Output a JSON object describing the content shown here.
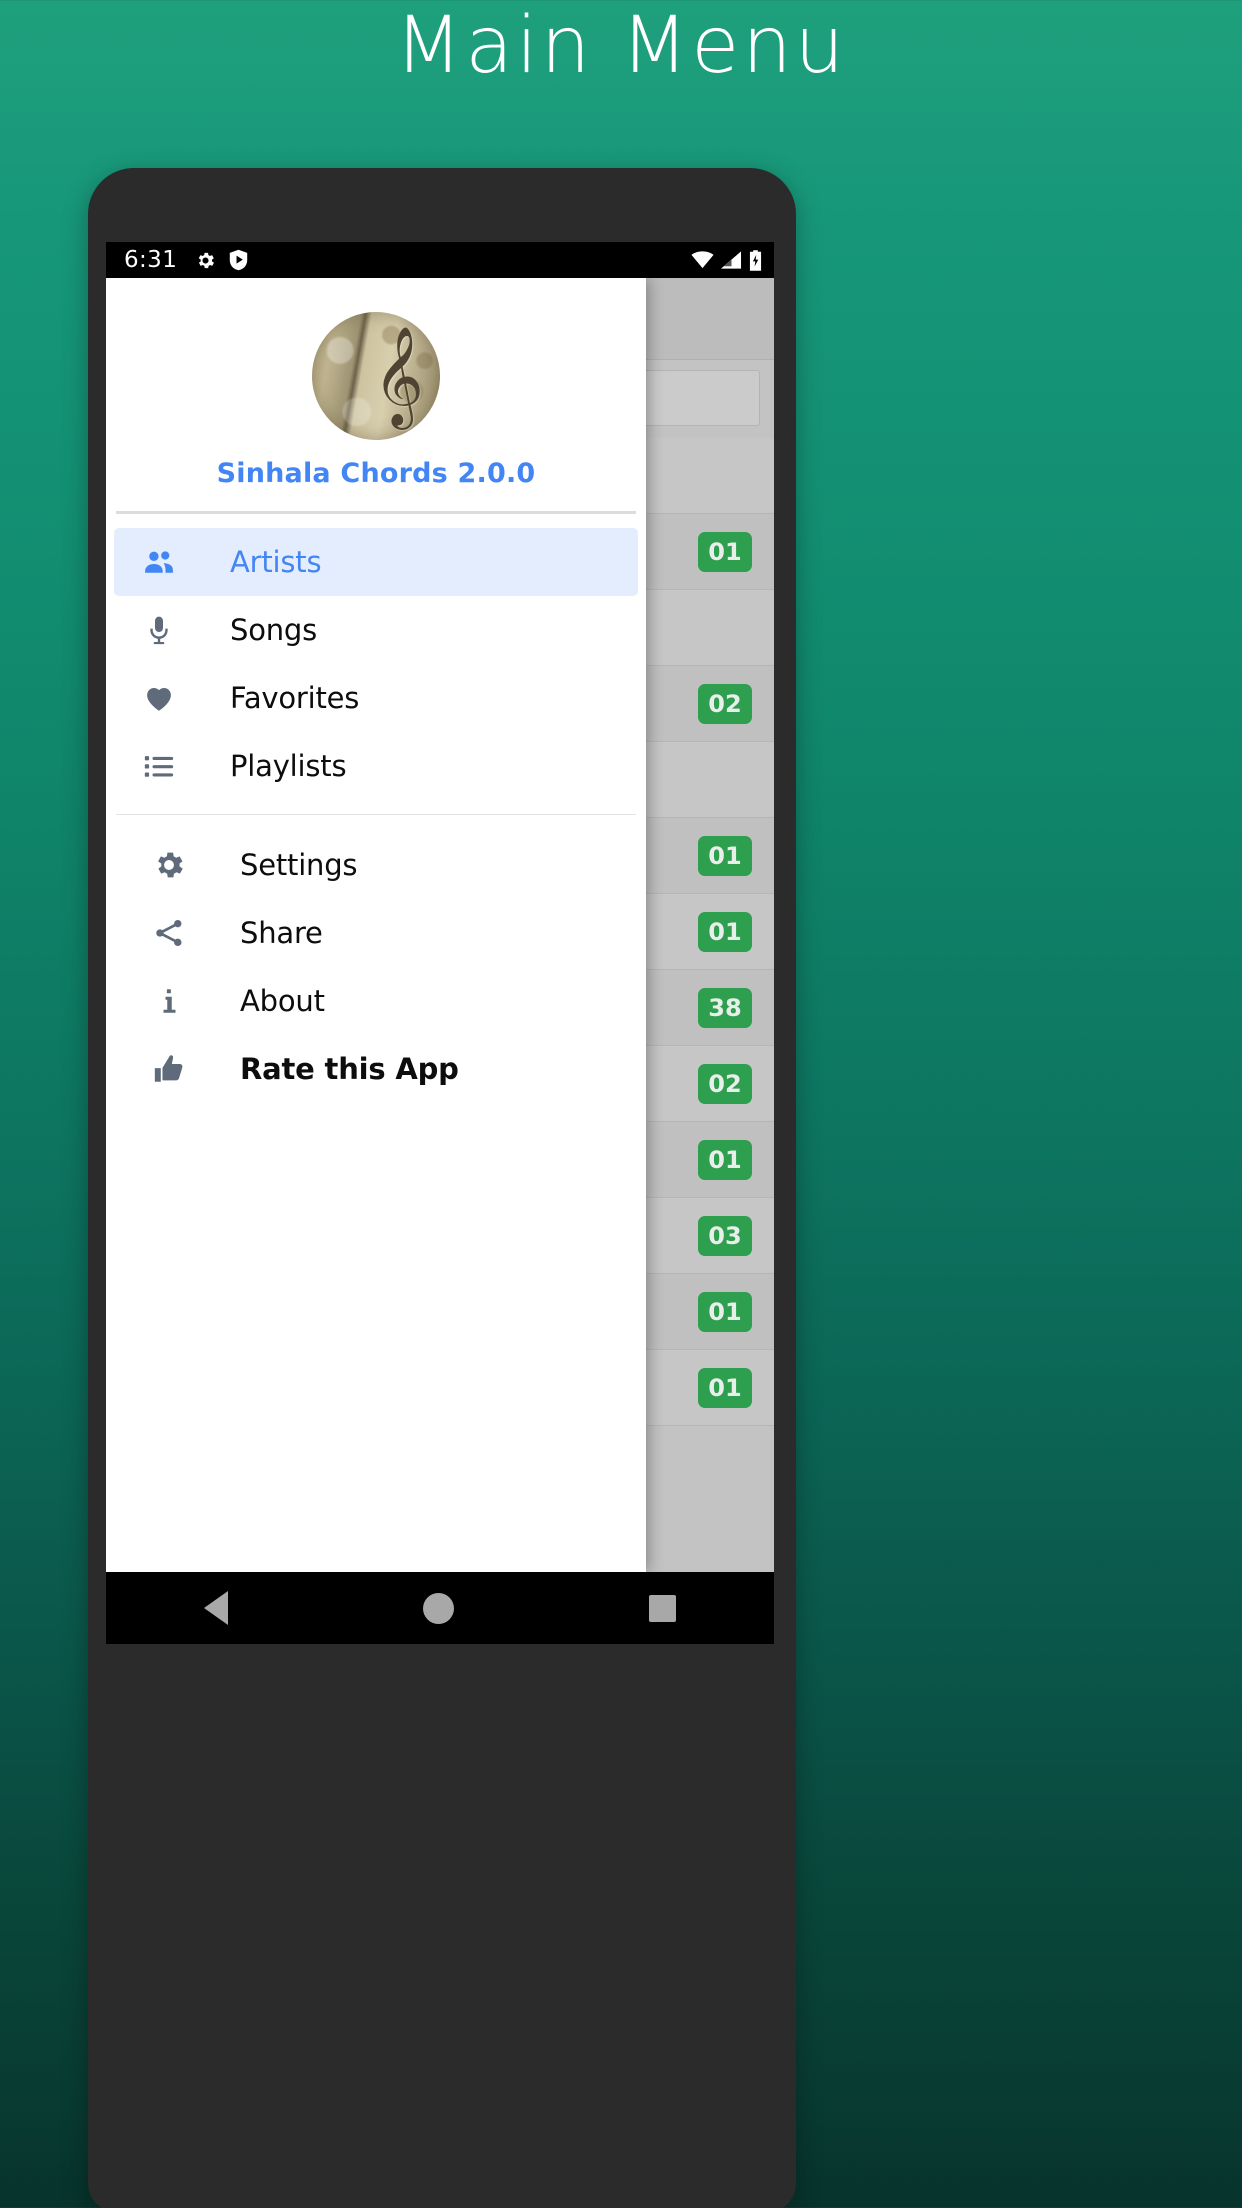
{
  "page": {
    "title": "Main Menu",
    "accent_green": "#1fa07c",
    "accent_blue": "#4285f4",
    "badge_green": "#2e9e4f"
  },
  "status_bar": {
    "time": "6:31",
    "left_icons": [
      "gear-icon",
      "play-protect-shield-icon"
    ],
    "right_icons": [
      "wifi-icon",
      "cellular-signal-icon",
      "battery-charging-icon"
    ]
  },
  "drawer": {
    "header": {
      "logo": "app-logo-treble-clef",
      "app_name_version": "Sinhala Chords 2.0.0"
    },
    "primary_items": [
      {
        "label": "Artists",
        "icon": "people-icon",
        "selected": true,
        "bold": false
      },
      {
        "label": "Songs",
        "icon": "microphone-icon",
        "selected": false,
        "bold": false
      },
      {
        "label": "Favorites",
        "icon": "heart-icon",
        "selected": false,
        "bold": false
      },
      {
        "label": "Playlists",
        "icon": "list-icon",
        "selected": false,
        "bold": false
      }
    ],
    "secondary_items": [
      {
        "label": "Settings",
        "icon": "gear-icon",
        "selected": false,
        "bold": false
      },
      {
        "label": "Share",
        "icon": "share-icon",
        "selected": false,
        "bold": false
      },
      {
        "label": "About",
        "icon": "info-icon",
        "selected": false,
        "bold": false
      },
      {
        "label": "Rate this App",
        "icon": "thumbs-up-icon",
        "selected": false,
        "bold": true
      }
    ]
  },
  "background_list": {
    "rows": [
      {
        "badge": ""
      },
      {
        "badge": "01"
      },
      {
        "badge": ""
      },
      {
        "badge": "02"
      },
      {
        "badge": ""
      },
      {
        "badge": "01"
      },
      {
        "badge": "01"
      },
      {
        "badge": "38"
      },
      {
        "badge": "02"
      },
      {
        "badge": "01"
      },
      {
        "badge": "03"
      },
      {
        "badge": "01"
      },
      {
        "badge": "01"
      }
    ]
  },
  "nav_bar": {
    "back_label": "back-button",
    "home_label": "home-button",
    "recents_label": "recents-button"
  }
}
